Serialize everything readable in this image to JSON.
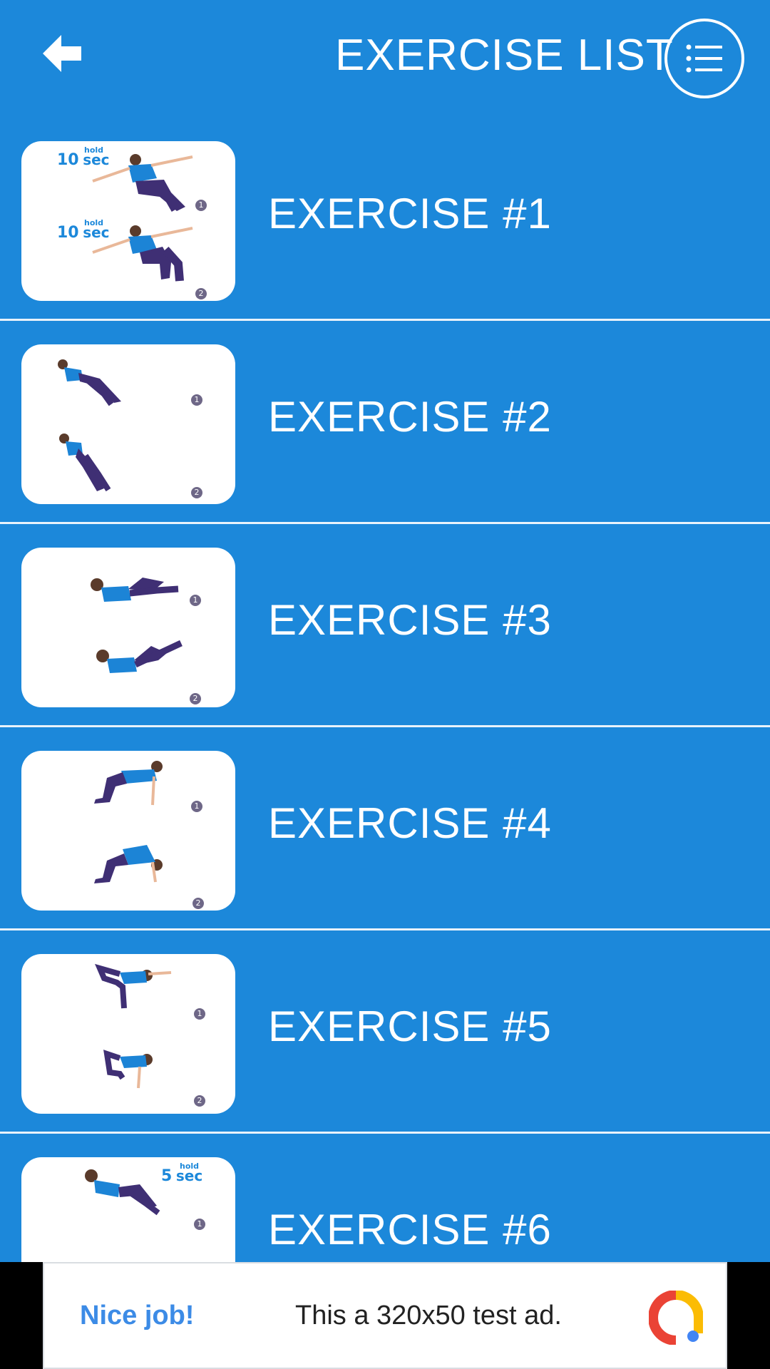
{
  "header": {
    "title": "EXERCISE LIST",
    "back_icon": "back-arrow-icon",
    "menu_icon": "list-menu-icon"
  },
  "exercises": [
    {
      "label": "EXERCISE #1",
      "hold": {
        "value": "10",
        "word": "hold",
        "unit": "sec"
      },
      "steps": [
        "1",
        "2"
      ]
    },
    {
      "label": "EXERCISE #2",
      "steps": [
        "1",
        "2"
      ]
    },
    {
      "label": "EXERCISE #3",
      "steps": [
        "1",
        "2"
      ]
    },
    {
      "label": "EXERCISE #4",
      "steps": [
        "1",
        "2"
      ]
    },
    {
      "label": "EXERCISE #5",
      "steps": [
        "1",
        "2"
      ]
    },
    {
      "label": "EXERCISE #6",
      "hold": {
        "value": "5",
        "word": "hold",
        "unit": "sec"
      },
      "steps": [
        "1"
      ]
    }
  ],
  "ad": {
    "left_text": "Nice job!",
    "center_text": "This a 320x50 test ad.",
    "logo": "ad-logo-icon"
  },
  "colors": {
    "background": "#1c88da",
    "card": "#ffffff",
    "figure_shirt": "#1c84d6",
    "figure_pants": "#3f2f74",
    "step_badge": "#6e6787"
  }
}
